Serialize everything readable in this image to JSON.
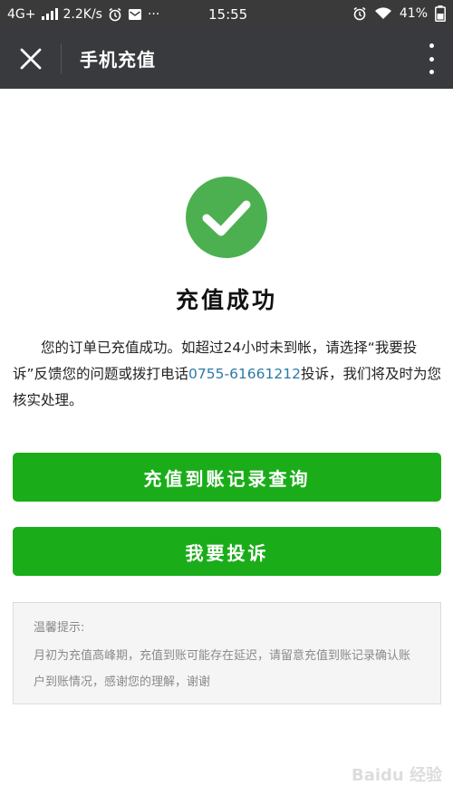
{
  "status_bar": {
    "network": "4G+",
    "speed": "2.2K/s",
    "more_dots": "···",
    "time": "15:55",
    "battery": "41%"
  },
  "header": {
    "title": "手机充值"
  },
  "result": {
    "title": "充值成功",
    "message_before": "您的订单已充值成功。如超过24小时未到帐，请选择“我要投诉”反馈您的问题或拨打电话",
    "phone": "0755-61661212",
    "message_after": "投诉，我们将及时为您核实处理。"
  },
  "buttons": {
    "query_label": "充值到账记录查询",
    "complain_label": "我要投诉"
  },
  "tips": {
    "title": "温馨提示:",
    "body": "月初为充值高峰期，充值到账可能存在延迟，请留意充值到账记录确认账户到账情况，感谢您的理解，谢谢"
  },
  "watermark": "Baidu 经验",
  "colors": {
    "accent_green": "#1aad19",
    "check_green": "#4cb050",
    "header_bg": "#393a3e",
    "phone_link": "#2a7aa8"
  }
}
